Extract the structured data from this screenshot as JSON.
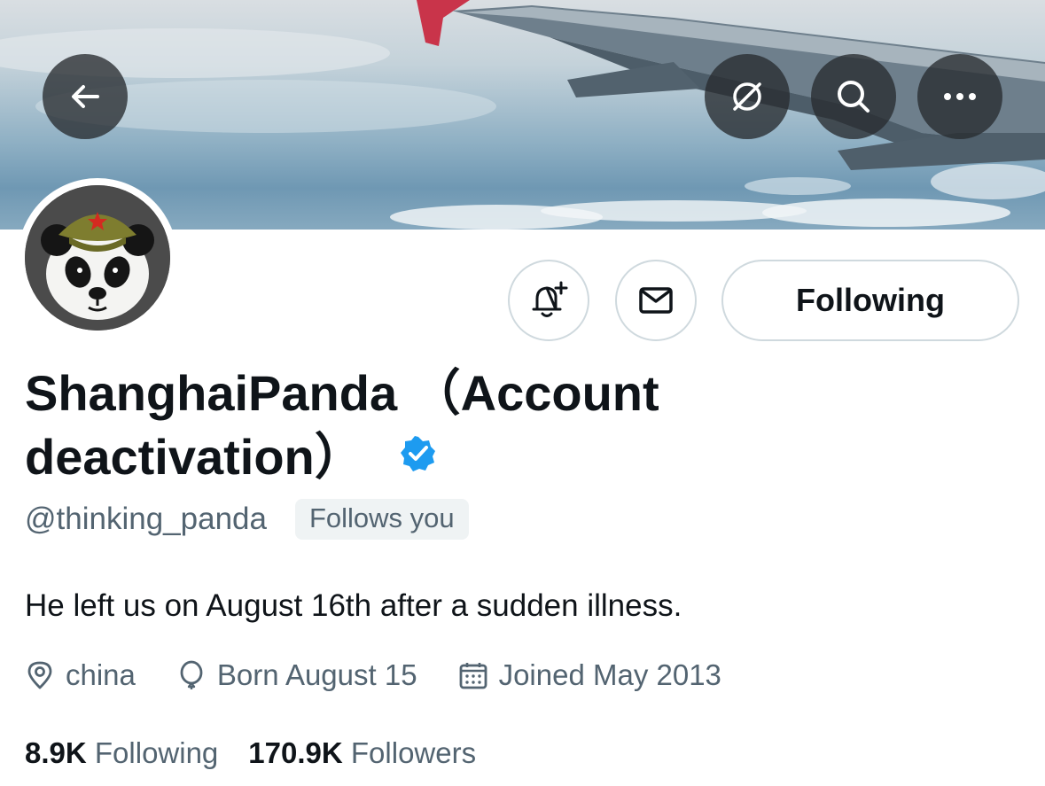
{
  "header": {
    "back_icon": "arrow-left-icon",
    "translate_icon": "globe-slash-icon",
    "search_icon": "search-icon",
    "more_icon": "more-horizontal-icon"
  },
  "profile": {
    "display_name_line1": "ShanghaiPanda （Account",
    "display_name_line2": "deactivation）",
    "handle": "@thinking_panda",
    "follows_you": "Follows you",
    "bio": "He left us on August 16th after a sudden illness.",
    "location": "china",
    "birthday": "Born August 15",
    "joined": "Joined May 2013",
    "following_count": "8.9K",
    "following_label": "Following",
    "followers_count": "170.9K",
    "followers_label": "Followers"
  },
  "actions": {
    "notify_icon": "bell-plus-icon",
    "message_icon": "envelope-icon",
    "following_button": "Following"
  },
  "colors": {
    "verified": "#1d9bf0",
    "secondary_text": "#536471",
    "primary_text": "#0f1419"
  }
}
